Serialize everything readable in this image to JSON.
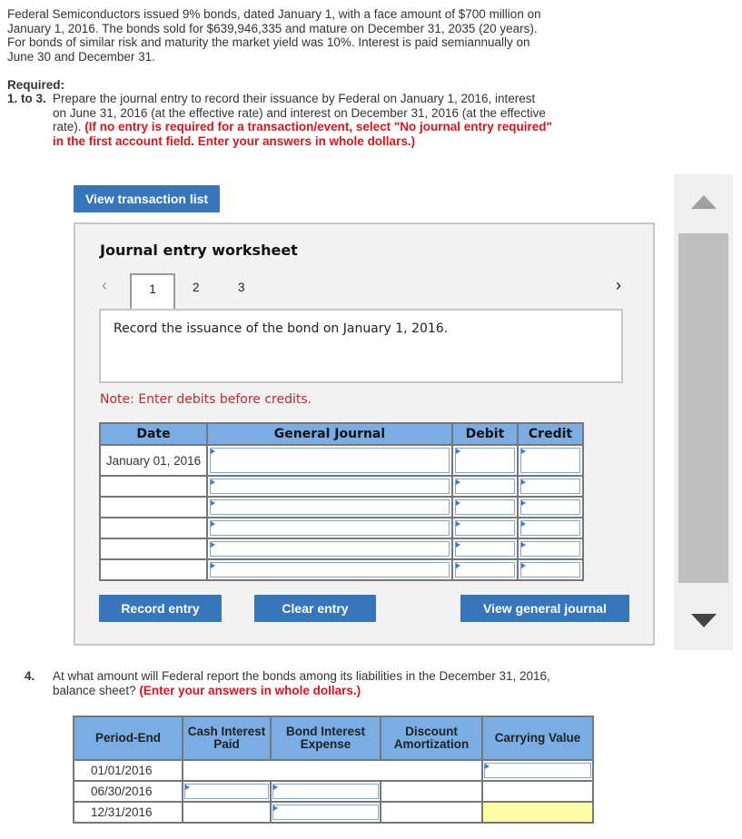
{
  "problem": {
    "text": "Federal Semiconductors issued 9% bonds, dated January 1, with a face amount of $700 million on January 1, 2016. The bonds sold for $639,946,335 and mature on December 31, 2035 (20 years). For bonds of similar risk and maturity the market yield was 10%. Interest is paid semiannually on June 30 and December 31.",
    "required_label": "Required:",
    "req_number": "1. to 3.",
    "req_text": "Prepare the journal entry to record their issuance by Federal on January 1, 2016, interest on June 31, 2016 (at the effective rate) and interest on December 31, 2016 (at the effective rate).",
    "req_instruction": "(If no entry is required for a transaction/event, select \"No journal entry required\" in the first account field. Enter your answers in whole dollars.)"
  },
  "buttons": {
    "view_transaction_list": "View transaction list",
    "record_entry": "Record entry",
    "clear_entry": "Clear entry",
    "view_general_journal": "View general journal"
  },
  "worksheet": {
    "title": "Journal entry worksheet",
    "prev_icon": "‹",
    "next_icon": "›",
    "tabs": [
      "1",
      "2",
      "3"
    ],
    "active_tab": "1",
    "description": "Record the issuance of the bond on January 1, 2016.",
    "note": "Note: Enter debits before credits.",
    "columns": [
      "Date",
      "General Journal",
      "Debit",
      "Credit"
    ],
    "rows": [
      {
        "date": "January 01, 2016",
        "account": "",
        "debit": "",
        "credit": ""
      },
      {
        "date": "",
        "account": "",
        "debit": "",
        "credit": ""
      },
      {
        "date": "",
        "account": "",
        "debit": "",
        "credit": ""
      },
      {
        "date": "",
        "account": "",
        "debit": "",
        "credit": ""
      },
      {
        "date": "",
        "account": "",
        "debit": "",
        "credit": ""
      },
      {
        "date": "",
        "account": "",
        "debit": "",
        "credit": ""
      }
    ]
  },
  "question4": {
    "number": "4.",
    "text": "At what amount will Federal report the bonds among its liabilities in the December 31, 2016, balance sheet?",
    "instruction": "(Enter your answers in whole dollars.)",
    "columns": [
      "Period-End",
      "Cash Interest Paid",
      "Bond Interest Expense",
      "Discount Amortization",
      "Carrying Value"
    ],
    "rows": [
      {
        "period": "01/01/2016",
        "cash": "",
        "expense": "",
        "discount": "",
        "carrying": ""
      },
      {
        "period": "06/30/2016",
        "cash": "",
        "expense": "",
        "discount": "",
        "carrying": ""
      },
      {
        "period": "12/31/2016",
        "cash": "",
        "expense": "",
        "discount": "",
        "carrying": ""
      }
    ]
  },
  "colors": {
    "button_blue": "#3676bb",
    "header_blue": "#7aade3",
    "instruction_red": "#e0131b",
    "note_red": "#c0272d",
    "highlight_yellow": "#fffea6"
  }
}
